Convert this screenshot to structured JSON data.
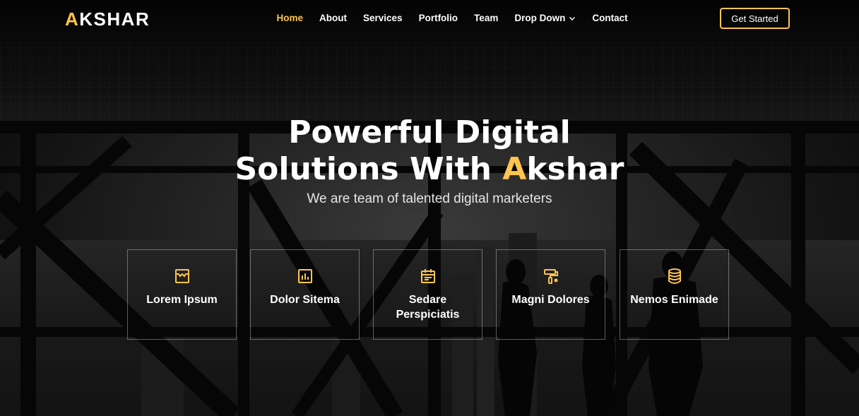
{
  "brand": {
    "first_letter": "A",
    "rest": "KSHAR"
  },
  "nav": {
    "items": [
      {
        "label": "Home",
        "active": true
      },
      {
        "label": "About"
      },
      {
        "label": "Services"
      },
      {
        "label": "Portfolio"
      },
      {
        "label": "Team"
      },
      {
        "label": "Drop Down",
        "has_dropdown": true
      },
      {
        "label": "Contact"
      }
    ]
  },
  "cta": {
    "label": "Get Started"
  },
  "hero": {
    "title_line1": "Powerful Digital",
    "title_line2_prefix": "Solutions With ",
    "title_line2_accent": "A",
    "title_line2_suffix": "kshar",
    "subtitle": "We are team of talented digital marketers"
  },
  "features": [
    {
      "label": "Lorem Ipsum",
      "icon": "store-icon"
    },
    {
      "label": "Dolor Sitema",
      "icon": "bar-chart-icon"
    },
    {
      "label": "Sedare Perspiciatis",
      "icon": "calendar-icon"
    },
    {
      "label": "Magni Dolores",
      "icon": "paint-roller-icon"
    },
    {
      "label": "Nemos Enimade",
      "icon": "database-icon"
    }
  ],
  "colors": {
    "accent": "#ffc451",
    "text": "#ffffff"
  }
}
